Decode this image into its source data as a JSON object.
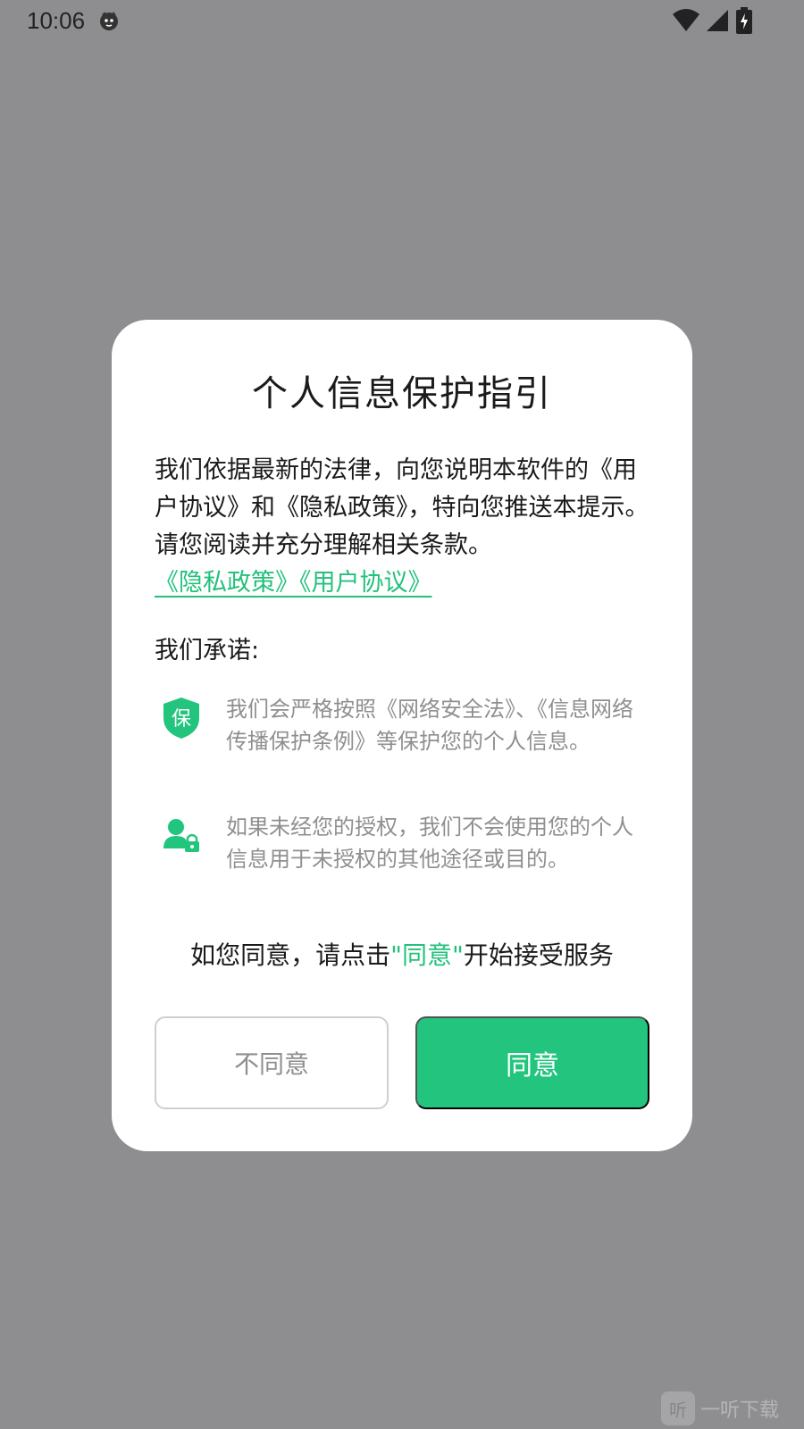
{
  "status_bar": {
    "time": "10:06"
  },
  "dialog": {
    "title": "个人信息保护指引",
    "intro": "我们依据最新的法律，向您说明本软件的《用户协议》和《隐私政策》，特向您推送本提示。请您阅读并充分理解相关条款。",
    "links": "《隐私政策》《用户协议》",
    "promise_heading": "我们承诺:",
    "promises": [
      {
        "icon": "shield-bao-icon",
        "badge": "保",
        "text": "我们会严格按照《网络安全法》、《信息网络传播保护条例》等保护您的个人信息。"
      },
      {
        "icon": "user-lock-icon",
        "text": "如果未经您的授权，我们不会使用您的个人信息用于未授权的其他途径或目的。"
      }
    ],
    "consent": {
      "before": "如您同意，请点击",
      "highlight": "\"同意\"",
      "after": "开始接受服务"
    },
    "buttons": {
      "disagree": "不同意",
      "agree": "同意"
    }
  },
  "watermark": {
    "logo": "听",
    "text": "一听下载"
  },
  "colors": {
    "accent": "#23c57e",
    "overlay": "#8e8e91",
    "muted_text": "#8f8f8f"
  }
}
